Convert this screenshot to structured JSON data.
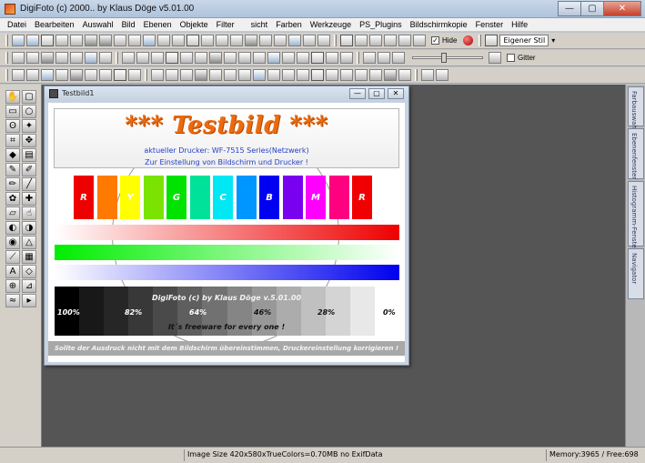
{
  "app": {
    "title": "DigiFoto (c) 2000.. by Klaus Döge v5.01.00",
    "window_buttons": {
      "minimize": "—",
      "maximize": "▢",
      "close": "✕"
    }
  },
  "menu": [
    "Datei",
    "Bearbeiten",
    "Auswahl",
    "Bild",
    "Ebenen",
    "Objekte",
    "Filter",
    "sicht",
    "Farben",
    "Werkzeuge",
    "PS_Plugins",
    "Bildschirmkopie",
    "Fenster",
    "Hilfe"
  ],
  "toolbar1": {
    "hide_label": "Hide",
    "hide_checked": "✓",
    "style_value": "Eigener Stil"
  },
  "toolbar2": {
    "gitter_label": "Gitter",
    "slider_value": 0.45
  },
  "document": {
    "title": "Testbild1",
    "buttons": {
      "minimize": "—",
      "restore": "▢",
      "close": "✕"
    },
    "heading": "*** Testbild ***",
    "printer_line": "aktueller Drucker: WF-7515 Series(Netzwerk)",
    "hint_line": "Zur Einstellung von Bildschirm und Drucker !",
    "swatches": [
      {
        "color": "#ef0000",
        "label": "R"
      },
      {
        "color": "#ff7a00",
        "label": ""
      },
      {
        "color": "#ffff00",
        "label": "Y"
      },
      {
        "color": "#7ae400",
        "label": ""
      },
      {
        "color": "#00e200",
        "label": "G"
      },
      {
        "color": "#00e29a",
        "label": ""
      },
      {
        "color": "#00e8f4",
        "label": "C"
      },
      {
        "color": "#0096ff",
        "label": ""
      },
      {
        "color": "#0000f2",
        "label": "B"
      },
      {
        "color": "#7a00f0",
        "label": ""
      },
      {
        "color": "#ff00ff",
        "label": "M"
      },
      {
        "color": "#ff0080",
        "label": ""
      },
      {
        "color": "#f00000",
        "label": "R"
      }
    ],
    "gradients": [
      "#ee0000",
      "#00ee00",
      "#0000ee"
    ],
    "gray_levels": [
      "#000000",
      "#181818",
      "#262626",
      "#383838",
      "#4a4a4a",
      "#5e5e5e",
      "#717171",
      "#858585",
      "#989898",
      "#acacac",
      "#c0c0c0",
      "#d4d4d4",
      "#e8e8e8",
      "#ffffff"
    ],
    "gray_labels": [
      "100%",
      "82%",
      "64%",
      "46%",
      "28%",
      "0%"
    ],
    "credit": "DigiFoto (c) by Klaus Döge v.5.01.00",
    "freeware": "It´s freeware for every one !",
    "warning": "Sollte der Ausdruck nicht mit dem Bildschirm übereinstimmen, Druckereinstellung korrigieren !"
  },
  "panel_tabs": [
    "Farbauswahl",
    "Ebenenfenster",
    "Histogramm-Fenster",
    "Navigator"
  ],
  "status": {
    "image_info": "Image Size 420x580xTrueColors=0.70MB  no ExifData",
    "memory": "Memory:3965 / Free:698"
  }
}
